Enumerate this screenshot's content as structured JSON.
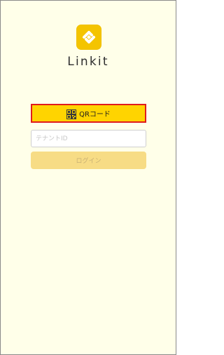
{
  "app": {
    "name": "Linkit",
    "logo_icon": "linkit-logo-icon"
  },
  "qr_button": {
    "icon": "qr-code-icon",
    "label": "QRコード"
  },
  "tenant_field": {
    "placeholder": "テナントID",
    "value": ""
  },
  "login_button": {
    "label": "ログイン"
  },
  "colors": {
    "background": "#FFFFE9",
    "accent": "#FFD400",
    "logo_yellow": "#F4C400",
    "highlight_border": "#E01C1C",
    "login_disabled": "#F7DC85"
  }
}
